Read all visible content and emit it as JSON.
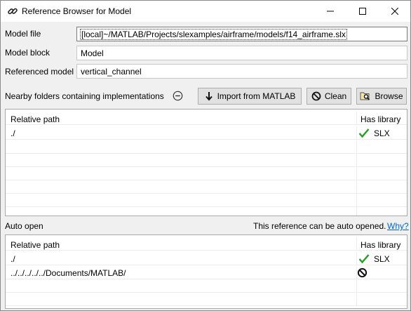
{
  "window": {
    "title": "Reference Browser for Model",
    "app_icon": "link-icon"
  },
  "form": {
    "model_file_label": "Model file",
    "model_file_value": "[local]~/MATLAB/Projects/slexamples/airframe/models/f14_airframe.slx",
    "model_block_label": "Model block",
    "model_block_value": "Model",
    "referenced_model_label": "Referenced model",
    "referenced_model_value": "vertical_channel"
  },
  "nearby": {
    "label": "Nearby folders containing implementations",
    "collapse_icon": "minus-circle-icon",
    "import_label": "Import from MATLAB",
    "clean_label": "Clean",
    "browse_label": "Browse",
    "table": {
      "headers": {
        "path": "Relative path",
        "library": "Has library"
      },
      "rows": [
        {
          "path": "./",
          "status": "check",
          "library": "SLX"
        }
      ]
    }
  },
  "auto_open": {
    "label": "Auto open",
    "message": "This reference can be auto opened.",
    "why_link": "Why?",
    "table": {
      "headers": {
        "path": "Relative path",
        "library": "Has library"
      },
      "rows": [
        {
          "path": "./",
          "status": "check",
          "library": "SLX"
        },
        {
          "path": "../../../../../Documents/MATLAB/",
          "status": "blocked",
          "library": ""
        }
      ]
    }
  },
  "colors": {
    "check": "#22a020",
    "link": "#0066cc"
  }
}
